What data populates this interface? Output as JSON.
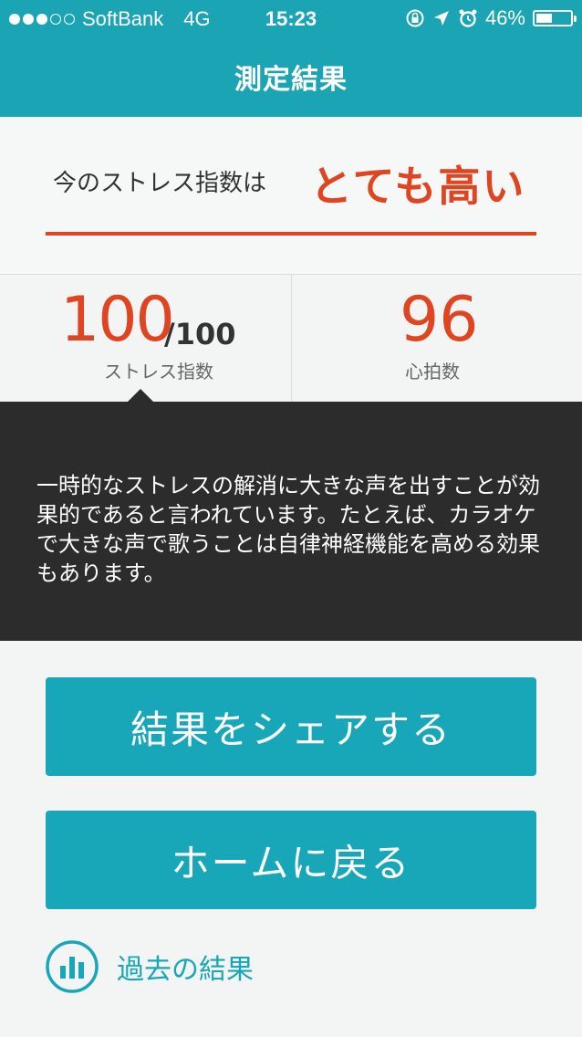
{
  "status_bar": {
    "carrier": "SoftBank",
    "network": "4G",
    "time": "15:23",
    "battery_percent": "46%",
    "battery_level": 0.46,
    "signal_bars_total": 5,
    "signal_bars_filled": 3,
    "icons": [
      "rotation-lock-icon",
      "location-arrow-icon",
      "alarm-icon",
      "battery-icon"
    ]
  },
  "nav": {
    "title": "測定結果"
  },
  "result": {
    "label": "今のストレス指数は",
    "level": "とても高い"
  },
  "stress": {
    "value": "100",
    "max": "/100",
    "caption": "ストレス指数"
  },
  "heart_rate": {
    "value": "96",
    "caption": "心拍数"
  },
  "tip": {
    "text": "一時的なストレスの解消に大きな声を出すことが効果的であると言われています。たとえば、カラオケで大きな声で歌うことは自律神経機能を高める効果もあります。"
  },
  "actions": {
    "share_label": "結果をシェアする",
    "home_label": "ホームに戻る",
    "history_label": "過去の結果"
  },
  "colors": {
    "brand_teal": "#1ba4b4",
    "accent_red": "#e04522",
    "tip_background": "#2c2c2c",
    "page_background": "#f3f4f4"
  }
}
